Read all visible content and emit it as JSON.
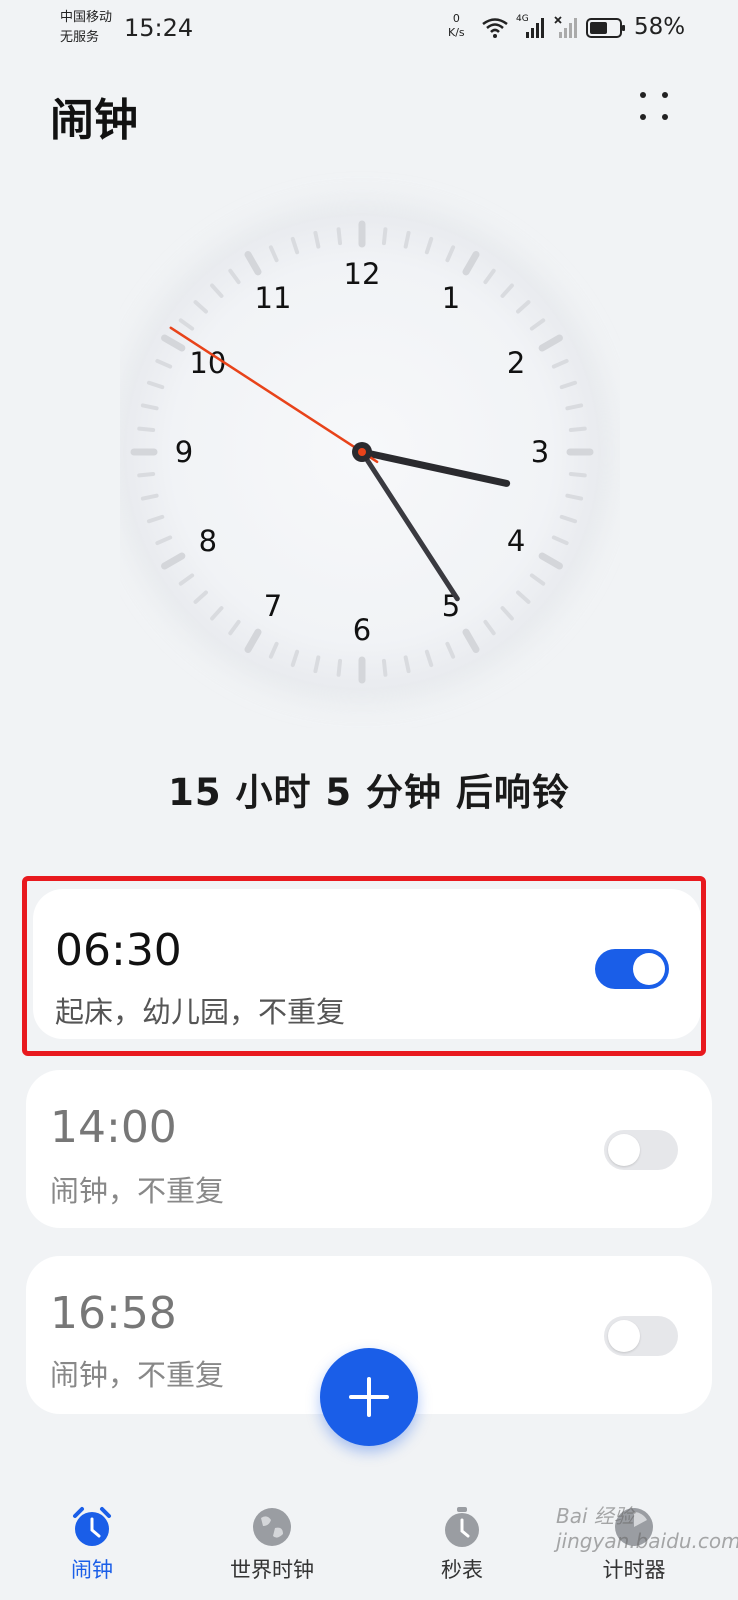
{
  "status_bar": {
    "carrier_line1": "中国移动",
    "carrier_line2": "无服务",
    "time": "15:24",
    "net_speed_value": "0",
    "net_speed_unit": "K/s",
    "network_type": "4G",
    "battery_percent": "58%"
  },
  "header": {
    "title": "闹钟"
  },
  "clock_face": {
    "numbers": [
      "12",
      "1",
      "2",
      "3",
      "4",
      "5",
      "6",
      "7",
      "8",
      "9",
      "10",
      "11"
    ],
    "hour": 3,
    "minute": 24.5,
    "second": 50.5
  },
  "countdown_text": "15 小时 5 分钟 后响铃",
  "alarms": [
    {
      "time": "06:30",
      "label": "起床，幼儿园，不重复",
      "enabled": true
    },
    {
      "time": "14:00",
      "label": "闹钟，不重复",
      "enabled": false
    },
    {
      "time": "16:58",
      "label": "闹钟，不重复",
      "enabled": false
    }
  ],
  "colors": {
    "accent": "#1a5ee8",
    "highlight_border": "#e8191e",
    "second_hand": "#e8431a"
  },
  "nav": {
    "items": [
      {
        "label": "闹钟",
        "icon": "alarm-clock-icon",
        "active": true
      },
      {
        "label": "世界时钟",
        "icon": "globe-icon",
        "active": false
      },
      {
        "label": "秒表",
        "icon": "stopwatch-icon",
        "active": false
      },
      {
        "label": "计时器",
        "icon": "timer-icon",
        "active": false
      }
    ]
  },
  "watermark": "Bai 经验 jingyan.baidu.com"
}
